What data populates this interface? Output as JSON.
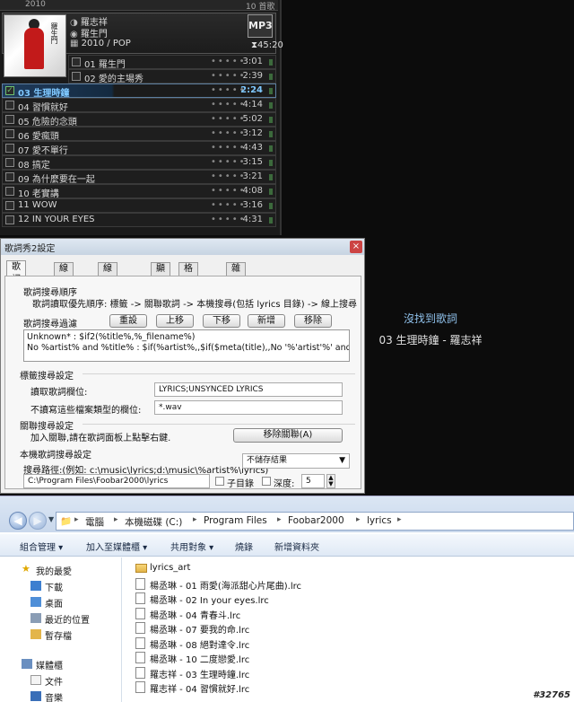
{
  "player": {
    "prev_year": "2010",
    "prev_count": "10 首歌",
    "cover_title": "羅生門",
    "artist": "羅志祥",
    "album": "羅生門",
    "year_genre": "2010 / POP",
    "format": "MP3",
    "total_duration": "45:20",
    "tracks": [
      {
        "name": "01 羅生門",
        "time": "3:01"
      },
      {
        "name": "02 愛的主場秀",
        "time": "2:39"
      },
      {
        "name": "03 生理時鐘",
        "time": "2:24",
        "current": true
      },
      {
        "name": "04 習慣就好",
        "time": "4:14"
      },
      {
        "name": "05 危險的念頭",
        "time": "5:02"
      },
      {
        "name": "06 愛瘋頭",
        "time": "3:12"
      },
      {
        "name": "07 愛不單行",
        "time": "4:43"
      },
      {
        "name": "08 搞定",
        "time": "3:15"
      },
      {
        "name": "09 為什麼要在一起",
        "time": "3:21"
      },
      {
        "name": "10 老實講",
        "time": "4:08"
      },
      {
        "name": "11 WOW",
        "time": "3:16"
      },
      {
        "name": "12 IN YOUR EYES",
        "time": "4:31"
      }
    ]
  },
  "lyrics_panel": {
    "status": "沒找到歌詞",
    "song": "03 生理時鐘 - 羅志祥"
  },
  "dialog": {
    "title": "歌詞秀2設定",
    "close": "×",
    "tabs": [
      "歌詞搜尋",
      "線上搜尋",
      "線上伺服器",
      "顯示",
      "格式字串",
      "雜項"
    ],
    "order_group": "歌詞搜尋順序",
    "order_text": "歌詞讀取優先順序: 標籤 -> 關聯歌詞 -> 本機搜尋(包括 lyrics 目錄) -> 線上搜尋",
    "filter_group": "歌詞搜尋過濾",
    "filter_buttons": [
      "重設",
      "上移",
      "下移",
      "新增",
      "移除"
    ],
    "filter_line1": "Unknown* : $if2(%title%,%_filename%)",
    "filter_line2": "No %artist% and %title% : $if(%artist%,,$if($meta(title),,No '%'artist'%' and '%'title'%'))",
    "tag_group": "標籤搜尋設定",
    "tag_read_label": "讀取歌詞欄位:",
    "tag_read_value": "LYRICS;UNSYNCED LYRICS",
    "tag_skip_label": "不讀寫這些檔案類型的欄位:",
    "tag_skip_value": "*.wav",
    "assoc_group": "關聯搜尋設定",
    "assoc_text": "加入關聯,請在歌詞面板上點擊右鍵.",
    "assoc_button": "移除關聯(A)",
    "local_group": "本機歌詞搜尋設定",
    "local_path_label": "搜尋路徑:(例如: c:\\music\\lyrics;d:\\music\\%artist%\\lyrics)",
    "local_save_select": "不儲存結果",
    "local_path_value": "C:\\Program Files\\Foobar2000\\lyrics",
    "subdir_label": "子目錄",
    "depth_label": "深度:",
    "depth_value": "5"
  },
  "explorer": {
    "breadcrumbs": [
      "電腦",
      "本機磁碟 (C:)",
      "Program Files",
      "Foobar2000",
      "lyrics"
    ],
    "toolbar": [
      "組合管理 ▾",
      "加入至媒體櫃 ▾",
      "共用對象 ▾",
      "燒錄",
      "新增資料夾"
    ],
    "nav": [
      "我的最愛",
      "下載",
      "桌面",
      "最近的位置",
      "暫存檔",
      "媒體櫃",
      "文件",
      "音樂"
    ],
    "files": [
      {
        "name": "lyrics_art",
        "folder": true
      },
      {
        "name": "楊丞琳 - 01 雨愛(海派甜心片尾曲).lrc"
      },
      {
        "name": "楊丞琳 - 02 In your eyes.lrc"
      },
      {
        "name": "楊丞琳 - 04 青春斗.lrc"
      },
      {
        "name": "楊丞琳 - 07 要我的命.lrc"
      },
      {
        "name": "楊丞琳 - 08 絕對達令.lrc"
      },
      {
        "name": "楊丞琳 - 10 二度戀愛.lrc"
      },
      {
        "name": "羅志祥 - 03 生理時鐘.lrc"
      },
      {
        "name": "羅志祥 - 04 習慣就好.lrc"
      }
    ]
  },
  "watermark": "#32765",
  "colors": {
    "player_bg": "#1a1a1a",
    "current_track": "#7fc8ff",
    "lyric_status": "#8fc0ea",
    "dialog_bg": "#f0f0f0",
    "explorer_toolbar": "#dfe9f5"
  }
}
